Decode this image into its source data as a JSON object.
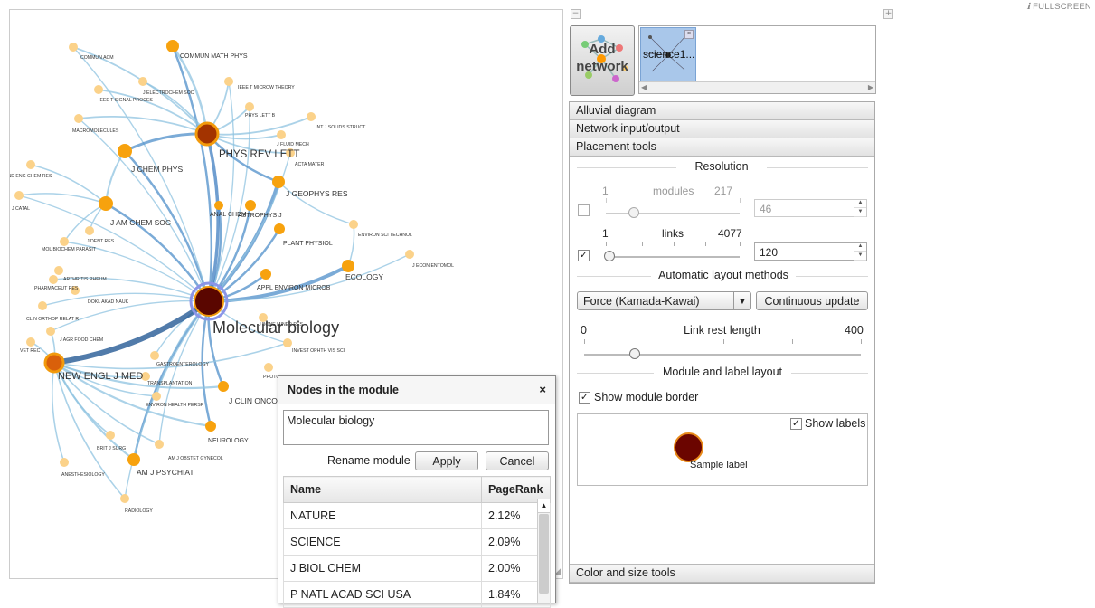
{
  "fullscreen": "FULLSCREEN",
  "fullscreen_icon": "ℹ",
  "add_network_label_1": "Add",
  "add_network_label_2": "network",
  "thumbnail_label": "science1...",
  "accordion": {
    "alluvial": "Alluvial diagram",
    "network_io": "Network input/output",
    "placement": "Placement tools",
    "color_size": "Color and size tools"
  },
  "placement": {
    "resolution_title": "Resolution",
    "modules_min": "1",
    "modules_label": "modules",
    "modules_max": "217",
    "modules_value": "46",
    "modules_checked": false,
    "links_min": "1",
    "links_label": "links",
    "links_max": "4077",
    "links_value": "120",
    "links_checked": true,
    "auto_layout_title": "Automatic layout methods",
    "layout_method": "Force (Kamada-Kawai)",
    "continuous_update": "Continuous update",
    "rest_min": "0",
    "rest_label": "Link rest length",
    "rest_max": "400",
    "rest_level": 0.18,
    "module_label_title": "Module and label layout",
    "show_border_label": "Show module border",
    "show_border_checked": true,
    "show_labels_label": "Show labels",
    "show_labels_checked": true,
    "sample_label": "Sample label"
  },
  "dialog": {
    "title": "Nodes in the module",
    "close": "×",
    "module_name": "Molecular biology",
    "rename_label": "Rename module",
    "apply": "Apply",
    "cancel": "Cancel",
    "col_name": "Name",
    "col_pagerank": "PageRank",
    "rows": [
      {
        "name": "NATURE",
        "pagerank": "2.12%"
      },
      {
        "name": "SCIENCE",
        "pagerank": "2.09%"
      },
      {
        "name": "J BIOL CHEM",
        "pagerank": "2.00%"
      },
      {
        "name": "P NATL ACAD SCI USA",
        "pagerank": "1.84%"
      }
    ]
  },
  "network": {
    "central_label": "Molecular biology",
    "big_labels": [
      "PHYS REV LETT",
      "NEW ENGL J MED"
    ],
    "mid_labels": [
      "J CHEM PHYS",
      "J AM CHEM SOC",
      "J GEOPHYS RES",
      "ECOLOGY",
      "AM J PSYCHIAT",
      "J CLIN ONCOL",
      "COMMUN MATH PHYS",
      "ASTROPHYS J",
      "PLANT PHYSIOL",
      "APPL ENVIRON MICROB",
      "NEUROLOGY",
      "ANAL CHEM"
    ],
    "small_labels": [
      "COMMUN ACM",
      "J ELECTROCHEM SOC",
      "IEEE T MICROW THEORY",
      "IEEE T SIGNAL PROCES",
      "PHYS LETT B",
      "INT J SOLIDS STRUCT",
      "MACROMOLECULES",
      "J FLUID MECH",
      "ACTA MATER",
      "IND ENG CHEM RES",
      "J CATAL",
      "J DENT RES",
      "MOL BIOCHEM PARASIT",
      "ENVIRON SCI TECHNOL",
      "J ECON ENTOMOL",
      "ARTHRITIS RHEUM",
      "PHARMACEUT RES",
      "DOKL AKAD NAUK",
      "CLIN ORTHOP RELAT R",
      "J BONE MINER RES",
      "J AGR FOOD CHEM",
      "VET REC",
      "INVEST OPHTH VIS SCI",
      "PHOTOCHEM PHOTOBIOL",
      "GASTROENTEROLOGY",
      "TRANSPLANTATION",
      "ENVIRON HEALTH PERSP",
      "BRIT J SURG",
      "AM J OBSTET GYNECOL",
      "ANESTHESIOLOGY",
      "RADIOLOGY"
    ],
    "colors": {
      "central": "#5a0600",
      "hub": "#a33300",
      "hub_ring": "#f29a0c",
      "module": "#f7a20e",
      "small": "#fbd28a",
      "link": "#8fc3e0",
      "link_dark": "#174f8e"
    }
  }
}
